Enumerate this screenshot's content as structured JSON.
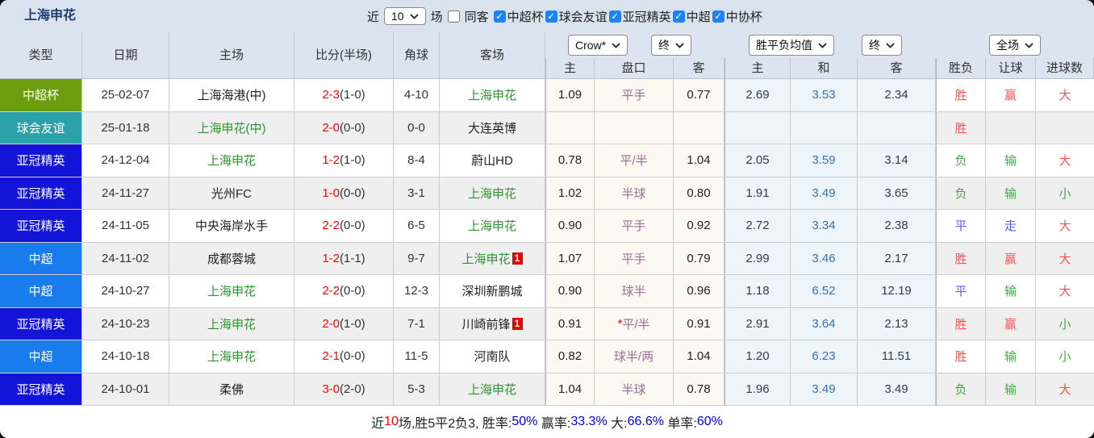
{
  "title": "上海申花",
  "toolbar": {
    "recent_label": "近",
    "recent_value": "10",
    "matches_label": "场",
    "same_venue": {
      "label": "同客",
      "checked": false
    },
    "leagues": [
      {
        "label": "中超杯",
        "checked": true
      },
      {
        "label": "球会友谊",
        "checked": true
      },
      {
        "label": "亚冠精英",
        "checked": true
      },
      {
        "label": "中超",
        "checked": true
      },
      {
        "label": "中协杯",
        "checked": true
      }
    ]
  },
  "header": {
    "left_columns": [
      "类型",
      "日期",
      "主场",
      "比分(半场)",
      "角球",
      "客场"
    ],
    "selects": {
      "bookmaker": "Crow*",
      "bookmaker_time": "终",
      "average": "胜平负均值",
      "average_time": "终",
      "scope": "全场"
    },
    "odds_subheaders": [
      "主",
      "盘口",
      "客"
    ],
    "average_subheaders": [
      "主",
      "和",
      "客"
    ],
    "result_subheaders": [
      "胜负",
      "让球",
      "进球数"
    ]
  },
  "colors": {
    "score_red": "#ff0000",
    "team_green": "#2e9430",
    "handicap": "#9a6f96",
    "handicap_star": "#ff0000",
    "avg_draw_blue": "#3a6fb0",
    "avg_num": "#323b48",
    "win": "#ff5252",
    "draw": "#5b5bff",
    "lose": "#4aa54a",
    "summary_blue": "#0000ee",
    "summary_red": "#ff0000",
    "type_colors": {
      "中超杯": "#6b9d0e",
      "球会友谊": "#2ba2a8",
      "亚冠精英": "#1414d8",
      "中超": "#187cec"
    }
  },
  "outcome_color_keys": {
    "胜": "win",
    "平": "draw",
    "负": "lose",
    "赢": "win",
    "走": "draw",
    "输": "lose",
    "大": "win",
    "小": "lose"
  },
  "rows": [
    {
      "type": "中超杯",
      "date": "25-02-07",
      "home": "上海海港(中)",
      "home_green": false,
      "score": "2-3",
      "half": "(1-0)",
      "corners": "4-10",
      "away": "上海申花",
      "away_green": true,
      "away_badge": "",
      "odds": {
        "home": "1.09",
        "handicap_star": "",
        "handicap": "平手",
        "away": "0.77"
      },
      "avg": {
        "home": "2.69",
        "draw": "3.53",
        "away": "2.34"
      },
      "result": {
        "outcome": "胜",
        "handicap": "赢",
        "goals": "大"
      }
    },
    {
      "type": "球会友谊",
      "date": "25-01-18",
      "home": "上海申花(中)",
      "home_green": true,
      "score": "2-0",
      "half": "(0-0)",
      "corners": "0-0",
      "away": "大连英博",
      "away_green": false,
      "away_badge": "",
      "odds": {
        "home": "",
        "handicap_star": "",
        "handicap": "",
        "away": ""
      },
      "avg": {
        "home": "",
        "draw": "",
        "away": ""
      },
      "result": {
        "outcome": "胜",
        "handicap": "",
        "goals": ""
      }
    },
    {
      "type": "亚冠精英",
      "date": "24-12-04",
      "home": "上海申花",
      "home_green": true,
      "score": "1-2",
      "half": "(1-0)",
      "corners": "8-4",
      "away": "蔚山HD",
      "away_green": false,
      "away_badge": "",
      "odds": {
        "home": "0.78",
        "handicap_star": "",
        "handicap": "平/半",
        "away": "1.04"
      },
      "avg": {
        "home": "2.05",
        "draw": "3.59",
        "away": "3.14"
      },
      "result": {
        "outcome": "负",
        "handicap": "输",
        "goals": "大"
      }
    },
    {
      "type": "亚冠精英",
      "date": "24-11-27",
      "home": "光州FC",
      "home_green": false,
      "score": "1-0",
      "half": "(0-0)",
      "corners": "3-1",
      "away": "上海申花",
      "away_green": true,
      "away_badge": "",
      "odds": {
        "home": "1.02",
        "handicap_star": "",
        "handicap": "半球",
        "away": "0.80"
      },
      "avg": {
        "home": "1.91",
        "draw": "3.49",
        "away": "3.65"
      },
      "result": {
        "outcome": "负",
        "handicap": "输",
        "goals": "小"
      }
    },
    {
      "type": "亚冠精英",
      "date": "24-11-05",
      "home": "中央海岸水手",
      "home_green": false,
      "score": "2-2",
      "half": "(0-0)",
      "corners": "6-5",
      "away": "上海申花",
      "away_green": true,
      "away_badge": "",
      "odds": {
        "home": "0.90",
        "handicap_star": "",
        "handicap": "平手",
        "away": "0.92"
      },
      "avg": {
        "home": "2.72",
        "draw": "3.34",
        "away": "2.38"
      },
      "result": {
        "outcome": "平",
        "handicap": "走",
        "goals": "大"
      }
    },
    {
      "type": "中超",
      "date": "24-11-02",
      "home": "成都蓉城",
      "home_green": false,
      "score": "1-2",
      "half": "(1-1)",
      "corners": "9-7",
      "away": "上海申花",
      "away_green": true,
      "away_badge": "1",
      "odds": {
        "home": "1.07",
        "handicap_star": "",
        "handicap": "平手",
        "away": "0.79"
      },
      "avg": {
        "home": "2.99",
        "draw": "3.46",
        "away": "2.17"
      },
      "result": {
        "outcome": "胜",
        "handicap": "赢",
        "goals": "大"
      }
    },
    {
      "type": "中超",
      "date": "24-10-27",
      "home": "上海申花",
      "home_green": true,
      "score": "2-2",
      "half": "(0-0)",
      "corners": "12-3",
      "away": "深圳新鹏城",
      "away_green": false,
      "away_badge": "",
      "odds": {
        "home": "0.90",
        "handicap_star": "",
        "handicap": "球半",
        "away": "0.96"
      },
      "avg": {
        "home": "1.18",
        "draw": "6.52",
        "away": "12.19"
      },
      "result": {
        "outcome": "平",
        "handicap": "输",
        "goals": "大"
      }
    },
    {
      "type": "亚冠精英",
      "date": "24-10-23",
      "home": "上海申花",
      "home_green": true,
      "score": "2-0",
      "half": "(1-0)",
      "corners": "7-1",
      "away": "川崎前锋",
      "away_green": false,
      "away_badge": "1",
      "odds": {
        "home": "0.91",
        "handicap_star": "*",
        "handicap": "平/半",
        "away": "0.91"
      },
      "avg": {
        "home": "2.91",
        "draw": "3.64",
        "away": "2.13"
      },
      "result": {
        "outcome": "胜",
        "handicap": "赢",
        "goals": "小"
      }
    },
    {
      "type": "中超",
      "date": "24-10-18",
      "home": "上海申花",
      "home_green": true,
      "score": "2-1",
      "half": "(0-0)",
      "corners": "11-5",
      "away": "河南队",
      "away_green": false,
      "away_badge": "",
      "odds": {
        "home": "0.82",
        "handicap_star": "",
        "handicap": "球半/两",
        "away": "1.04"
      },
      "avg": {
        "home": "1.20",
        "draw": "6.23",
        "away": "11.51"
      },
      "result": {
        "outcome": "胜",
        "handicap": "输",
        "goals": "小"
      }
    },
    {
      "type": "亚冠精英",
      "date": "24-10-01",
      "home": "柔佛",
      "home_green": false,
      "score": "3-0",
      "half": "(2-0)",
      "corners": "5-3",
      "away": "上海申花",
      "away_green": true,
      "away_badge": "",
      "odds": {
        "home": "1.04",
        "handicap_star": "",
        "handicap": "半球",
        "away": "0.78"
      },
      "avg": {
        "home": "1.96",
        "draw": "3.49",
        "away": "3.49"
      },
      "result": {
        "outcome": "负",
        "handicap": "输",
        "goals": "大"
      }
    }
  ],
  "summary": {
    "segments": [
      {
        "text": "近",
        "color": "#222"
      },
      {
        "text": "10",
        "color": "#ff0000"
      },
      {
        "text": "场,胜5平2负3, 胜率:",
        "color": "#222"
      },
      {
        "text": "50%",
        "color": "#0000ee"
      },
      {
        "text": " 赢率:",
        "color": "#222"
      },
      {
        "text": "33.3%",
        "color": "#0000ee"
      },
      {
        "text": " 大:",
        "color": "#222"
      },
      {
        "text": "66.6%",
        "color": "#0000ee"
      },
      {
        "text": " 单率:",
        "color": "#222"
      },
      {
        "text": "60%",
        "color": "#0000ee"
      }
    ]
  }
}
